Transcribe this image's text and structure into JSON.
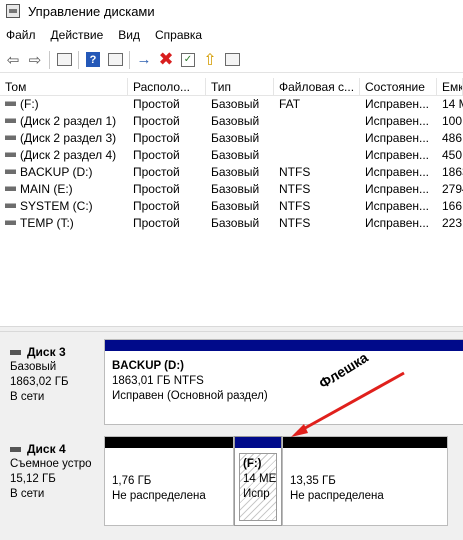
{
  "window": {
    "title": "Управление дисками"
  },
  "menu": [
    "Файл",
    "Действие",
    "Вид",
    "Справка"
  ],
  "toolbar": {
    "icons": [
      "back-arrow-icon",
      "forward-arrow-icon",
      "console-icon",
      "help-icon",
      "properties-icon",
      "connect-icon",
      "delete-icon",
      "check-icon",
      "move-up-icon",
      "settings-icon"
    ]
  },
  "table": {
    "columns": [
      "Том",
      "Располо...",
      "Тип",
      "Файловая с...",
      "Состояние",
      "Емк"
    ],
    "rows": [
      {
        "volume": "(F:)",
        "layout": "Простой",
        "type": "Базовый",
        "fs": "FAT",
        "status": "Исправен...",
        "capacity": "14 М"
      },
      {
        "volume": "(Диск 2 раздел 1)",
        "layout": "Простой",
        "type": "Базовый",
        "fs": "",
        "status": "Исправен...",
        "capacity": "100"
      },
      {
        "volume": "(Диск 2 раздел 3)",
        "layout": "Простой",
        "type": "Базовый",
        "fs": "",
        "status": "Исправен...",
        "capacity": "486"
      },
      {
        "volume": "(Диск 2 раздел 4)",
        "layout": "Простой",
        "type": "Базовый",
        "fs": "",
        "status": "Исправен...",
        "capacity": "450"
      },
      {
        "volume": "BACKUP (D:)",
        "layout": "Простой",
        "type": "Базовый",
        "fs": "NTFS",
        "status": "Исправен...",
        "capacity": "1863"
      },
      {
        "volume": "MAIN (E:)",
        "layout": "Простой",
        "type": "Базовый",
        "fs": "NTFS",
        "status": "Исправен...",
        "capacity": "2794"
      },
      {
        "volume": "SYSTEM (C:)",
        "layout": "Простой",
        "type": "Базовый",
        "fs": "NTFS",
        "status": "Исправен...",
        "capacity": "166,"
      },
      {
        "volume": "TEMP (T:)",
        "layout": "Простой",
        "type": "Базовый",
        "fs": "NTFS",
        "status": "Исправен...",
        "capacity": "223,"
      }
    ]
  },
  "disks": {
    "disk3": {
      "name": "Диск 3",
      "type": "Базовый",
      "size": "1863,02 ГБ",
      "status": "В сети",
      "partition": {
        "title": "BACKUP  (D:)",
        "size": "1863,01 ГБ NTFS",
        "status": "Исправен (Основной раздел)"
      }
    },
    "disk4": {
      "name": "Диск 4",
      "type": "Съемное устро",
      "size": "15,12 ГБ",
      "status": "В сети",
      "p1": {
        "size": "1,76 ГБ",
        "status": "Не распределена"
      },
      "p2": {
        "title": "(F:)",
        "size": "14 МЕ",
        "status": "Испр"
      },
      "p3": {
        "size": "13,35 ГБ",
        "status": "Не распределена"
      }
    }
  },
  "annotation": {
    "text": "Флешка",
    "color": "#e0201c"
  }
}
